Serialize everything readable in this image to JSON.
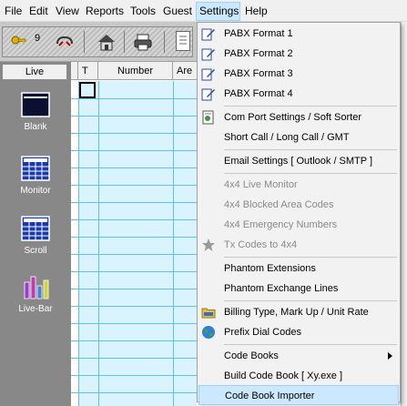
{
  "menubar": {
    "items": [
      {
        "label": "File"
      },
      {
        "label": "Edit"
      },
      {
        "label": "View"
      },
      {
        "label": "Reports"
      },
      {
        "label": "Tools"
      },
      {
        "label": "Guest"
      },
      {
        "label": "Settings"
      },
      {
        "label": "Help"
      }
    ]
  },
  "toolbar": {
    "key_count": "9",
    "icons": [
      "key-icon",
      "phone-transfer-icon",
      "home-icon",
      "printer-icon",
      "document-icon"
    ]
  },
  "sidebar": {
    "header": "Live",
    "items": [
      {
        "label": "Blank",
        "icon": "blank-icon"
      },
      {
        "label": "Monitor",
        "icon": "monitor-grid-icon"
      },
      {
        "label": "Scroll",
        "icon": "scroll-grid-icon"
      },
      {
        "label": "Live-Bar",
        "icon": "bar-chart-icon"
      }
    ]
  },
  "grid": {
    "columns": [
      "T",
      "Number",
      "Are"
    ]
  },
  "settings_menu": {
    "items": [
      {
        "label": "PABX Format 1",
        "icon": "edit-pencil-icon"
      },
      {
        "label": "PABX Format 2",
        "icon": "edit-pencil-icon"
      },
      {
        "label": "PABX Format 3",
        "icon": "edit-pencil-icon"
      },
      {
        "label": "PABX Format 4",
        "icon": "edit-pencil-icon"
      },
      {
        "label": "Com Port Settings / Soft Sorter",
        "icon": "document-settings-icon"
      },
      {
        "label": "Short Call / Long Call / GMT"
      },
      {
        "label": "Email Settings [ Outlook / SMTP ]"
      },
      {
        "label": "4x4 Live Monitor"
      },
      {
        "label": "4x4 Blocked Area Codes"
      },
      {
        "label": "4x4 Emergency Numbers"
      },
      {
        "label": "Tx Codes to 4x4",
        "icon": "star-icon"
      },
      {
        "label": "Phantom Extensions"
      },
      {
        "label": "Phantom Exchange Lines"
      },
      {
        "label": "Billing Type, Mark Up / Unit Rate",
        "icon": "billing-folder-icon"
      },
      {
        "label": "Prefix Dial Codes",
        "icon": "globe-icon"
      },
      {
        "label": "Code Books"
      },
      {
        "label": "Build Code Book [ Xy.exe ]"
      },
      {
        "label": "Code Book Importer"
      }
    ]
  },
  "colors": {
    "grid_cell": "#d9f3ff",
    "grid_line": "#5fc0e8",
    "sidebar_bg": "#888888",
    "menu_highlight": "#cce8ff"
  }
}
